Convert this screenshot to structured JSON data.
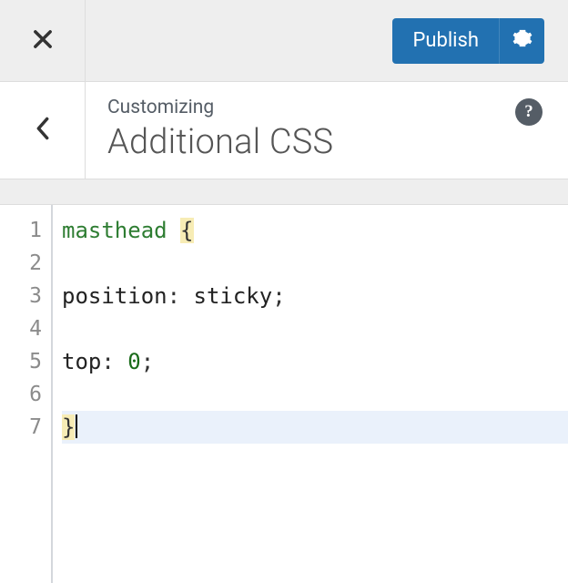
{
  "topbar": {
    "publish_label": "Publish"
  },
  "header": {
    "overline": "Customizing",
    "title": "Additional CSS",
    "help_label": "?"
  },
  "editor": {
    "lines": [
      {
        "n": "1",
        "tokens": [
          {
            "t": "masthead",
            "c": "tok-sel"
          },
          {
            "t": " ",
            "c": ""
          },
          {
            "t": "{",
            "c": "tok-brace"
          }
        ]
      },
      {
        "n": "2",
        "tokens": []
      },
      {
        "n": "3",
        "tokens": [
          {
            "t": "position",
            "c": "tok-prop"
          },
          {
            "t": ": ",
            "c": ""
          },
          {
            "t": "sticky",
            "c": "tok-val"
          },
          {
            "t": ";",
            "c": ""
          }
        ]
      },
      {
        "n": "4",
        "tokens": []
      },
      {
        "n": "5",
        "tokens": [
          {
            "t": "top",
            "c": "tok-prop"
          },
          {
            "t": ": ",
            "c": ""
          },
          {
            "t": "0",
            "c": "tok-num"
          },
          {
            "t": ";",
            "c": ""
          }
        ]
      },
      {
        "n": "6",
        "tokens": []
      },
      {
        "n": "7",
        "tokens": [
          {
            "t": "}",
            "c": "tok-brace"
          }
        ],
        "active": true,
        "cursor_after": true
      }
    ]
  }
}
